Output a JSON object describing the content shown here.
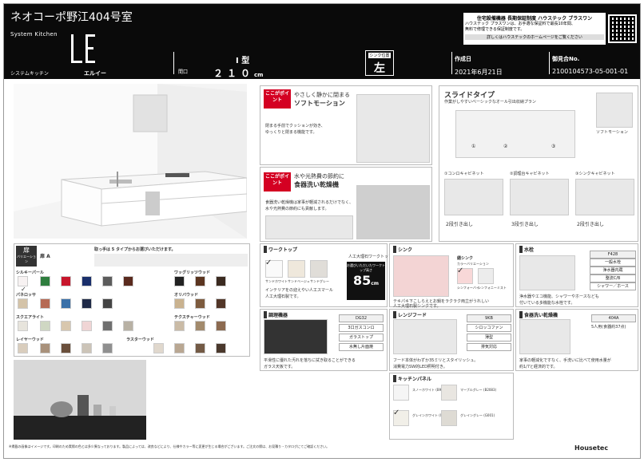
{
  "header": {
    "title": "ネオコーポ野江404号室",
    "brand_en": "System Kitchen",
    "brand_jp": "システムキッチン",
    "model_name": "エルイー",
    "logo_text": "LE",
    "frontage_label": "間口",
    "type": "I 型",
    "width": "２１０",
    "width_unit": "cm",
    "sink_pos_label": "シンク位置",
    "sink_pos": "左",
    "date_label": "作成日",
    "date": "2021年6月21日",
    "no_label": "御見合No.",
    "no": "2100104573-05-001-01"
  },
  "warranty": {
    "title": "住宅設備機器 長期保証制度 ハウステック ブラスワン",
    "line1": "ハウステック プラスワンは、お手選な保証料で最長10年間、",
    "line2": "無料で修理できる保証制度です。",
    "link": "詳しくはハウステックのホームページをご覧ください"
  },
  "door": {
    "heading": "扉",
    "sub": "バリエーション",
    "current": "扉 A",
    "choose": "取っ手は 5 タイプからお選びいただけます。",
    "groups": [
      "シルキーパール",
      "パネロッサ",
      "スクエアライト",
      "レイヤーウッド",
      "ワッグリッツウッド",
      "オリバウッド",
      "ラスターウッド",
      "テクスチャーウッド"
    ]
  },
  "point1": {
    "badge": "ここがポイント",
    "lead": "やさしく静かに閉まる",
    "title": "ソフトモーション",
    "desc1": "閉まる手前でクッションが効き、",
    "desc2": "ゆっくりと閉まる機能です。"
  },
  "point2": {
    "badge": "ここがポイント",
    "lead": "水や光熱費の節約に",
    "title": "食器洗い乾燥機",
    "desc1": "食器洗い乾燥機は家事が軽減されるだけでなく、",
    "desc2": "水や光熱費の節約にも貢献します。"
  },
  "slide": {
    "title": "スライドタイプ",
    "sub": "作業がしやすいベーシックなオール引出収納プラン",
    "soft": "ソフトモーション",
    "nums": [
      "①",
      "②",
      "③"
    ],
    "c1": "①コンロキャビネット",
    "c2": "②調理台キャビネット",
    "c3": "③シンクキャビネット",
    "d1": "2段引き出し",
    "d2": "3段引き出し",
    "d3": "2段引き出し"
  },
  "worktop": {
    "heading": "ワークトップ",
    "material": "人工大理石ワークトップ",
    "height_label": "お選びいただいたワークトップ高さ",
    "height": "85",
    "unit": "cm",
    "desc1": "インテリアをの迎えやい人工スマール",
    "desc2": "人工大理石製です。",
    "opts": [
      "サンドホワイト",
      "サンドベージュ",
      "サンドグレー"
    ]
  },
  "sink": {
    "heading": "シンク",
    "kind": "繕シンク",
    "color_label": "カラーバリエーション",
    "opts": [
      "シンフォーバイ",
      "シンフォニーミスト"
    ],
    "desc1": "テキパキ下こしらえとお鍋をラクラク両立がうれしい",
    "desc2": "人工大理石製シンクです。"
  },
  "faucet": {
    "heading": "水栓",
    "model": "F428",
    "tags": [
      "一般水栓",
      "浄水器内蔵",
      "整流C/B",
      "シャワー／ホース"
    ],
    "desc1": "浄水器やエコ機能、シャワーやホースなども",
    "desc2": "付いている多機能な水栓です。"
  },
  "stove": {
    "heading": "調理機器",
    "model": "DG32",
    "tags": [
      "3口ガスコンロ",
      "ガラストップ",
      "水無し片面焼"
    ],
    "desc1": "平滑性に優れた汚れを落ちに拭き取ることができる",
    "desc2": "ガラス天板です。"
  },
  "hood": {
    "heading": "レンジフード",
    "model": "9KB",
    "tags": [
      "シロッコファン",
      "薄型",
      "排気対応"
    ],
    "desc1": "フード本体がわずか35ミリとスタイリッシュ。",
    "desc2": "消費電力SW的LED照明付き。"
  },
  "dish": {
    "heading": "食器洗い乾燥機",
    "model": "404A",
    "spec": "5人用(食器約37点)",
    "desc1": "家事の軽減化ですなく、手洗いに比べて使用水量が",
    "desc2": "約1/7と経済的です。"
  },
  "panel": {
    "heading": "キッチンパネル",
    "opts": [
      "スノーホワイト (B90)",
      "マーブルグレー (B2083)",
      "グレインホワイト (W001)",
      "グレイングレー (G001)"
    ]
  },
  "footer": {
    "note": "※掲載の画像はイメージです。印刷のため実際の色とは多少異なっております。製品によっては、改良などにより、仕様やカラー等に変更が生じる場合がございます。ご注文の際は、お見積り・カタログにてご確認ください。",
    "logo": "Housetec"
  }
}
